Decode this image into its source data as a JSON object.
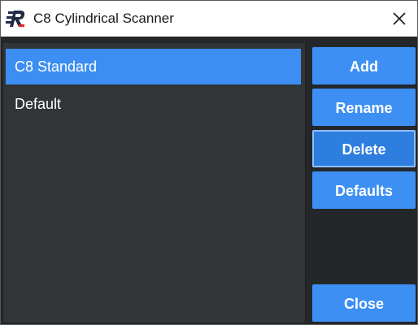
{
  "window": {
    "title": "C8 Cylindrical Scanner",
    "logo_icon": "r-logo-icon",
    "close_icon": "close-icon"
  },
  "list": {
    "items": [
      {
        "label": "C8 Standard",
        "selected": true
      },
      {
        "label": "Default",
        "selected": false
      }
    ]
  },
  "buttons": {
    "add": "Add",
    "rename": "Rename",
    "delete": "Delete",
    "defaults": "Defaults",
    "close": "Close"
  },
  "colors": {
    "accent": "#3d8ff3",
    "selection": "#3c8ef2",
    "list_bg": "#313538",
    "panel_bg": "#24272a"
  }
}
